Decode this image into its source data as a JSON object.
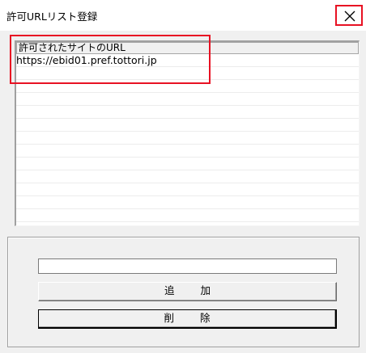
{
  "window": {
    "title": "許可URLリスト登録",
    "close_icon": "close-icon"
  },
  "list": {
    "header": "許可されたサイトのURL",
    "rows": [
      "https://ebid01.pref.tottori.jp"
    ]
  },
  "form": {
    "url_input_value": "",
    "add_label": "追 加",
    "delete_label": "削 除"
  },
  "colors": {
    "highlight": "#e81123",
    "window_bg": "#f0f0f0"
  }
}
